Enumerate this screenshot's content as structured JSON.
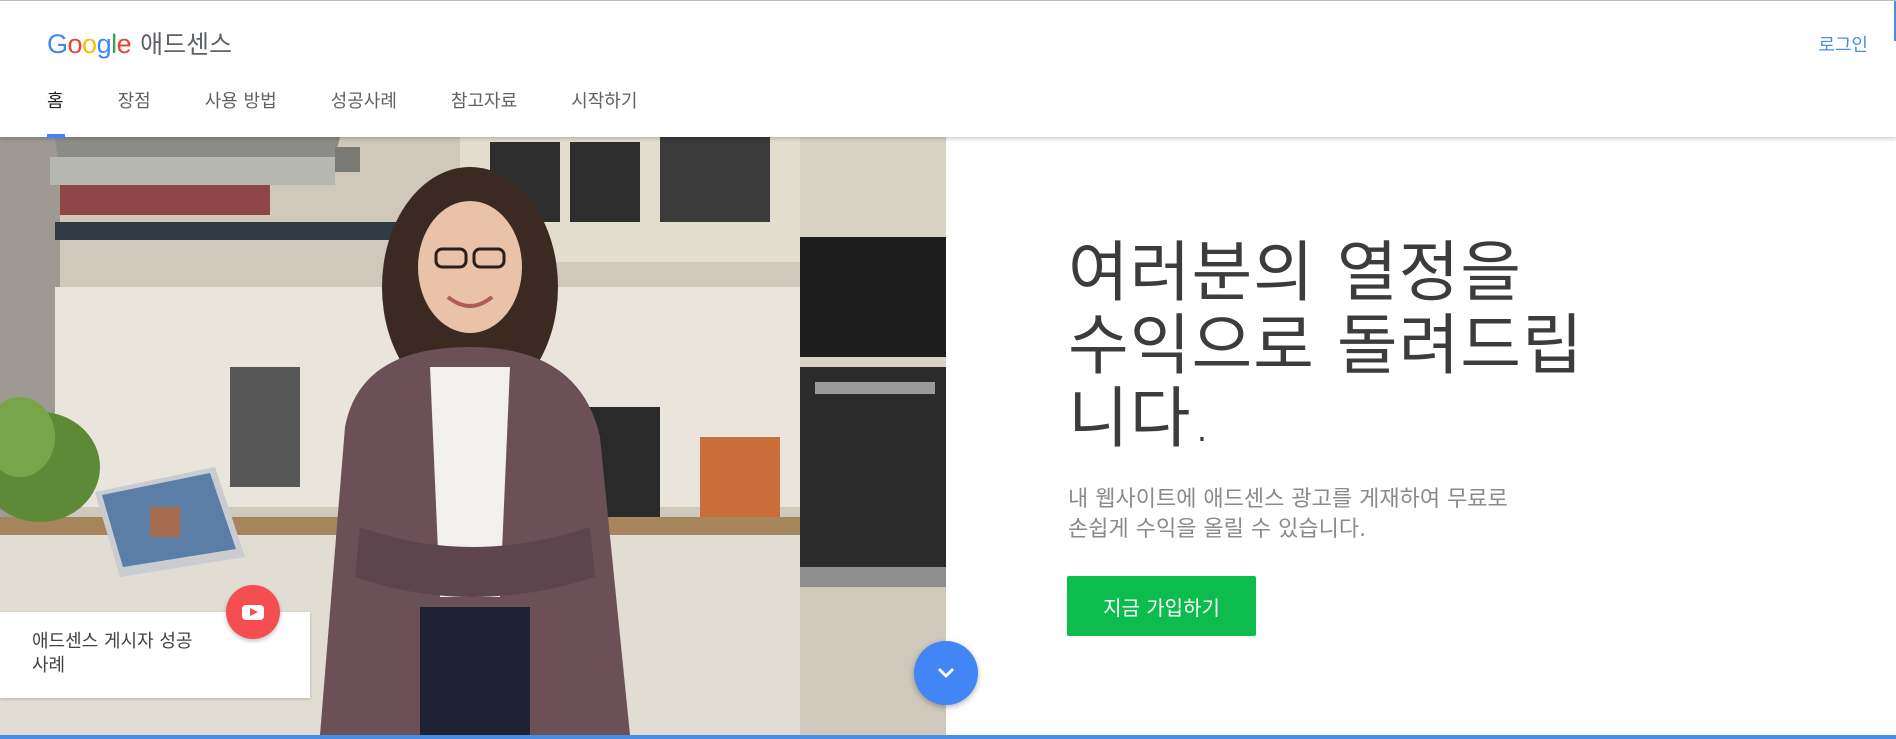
{
  "header": {
    "logo_letters": [
      {
        "ch": "G",
        "color": "#4285f4"
      },
      {
        "ch": "o",
        "color": "#ea4335"
      },
      {
        "ch": "o",
        "color": "#fbbc05"
      },
      {
        "ch": "g",
        "color": "#4285f4"
      },
      {
        "ch": "l",
        "color": "#34a853"
      },
      {
        "ch": "e",
        "color": "#ea4335"
      }
    ],
    "product_name": "애드센스",
    "login_label": "로그인"
  },
  "nav": {
    "items": [
      {
        "label": "홈",
        "active": true
      },
      {
        "label": "장점",
        "active": false
      },
      {
        "label": "사용 방법",
        "active": false
      },
      {
        "label": "성공사례",
        "active": false
      },
      {
        "label": "참고자료",
        "active": false
      },
      {
        "label": "시작하기",
        "active": false
      }
    ]
  },
  "hero": {
    "title_lines": [
      "여러분의 열정을",
      "수익으로 돌려드립",
      "니다."
    ],
    "subtitle_lines": [
      "내 웹사이트에 애드센스 광고를 게재하여 무료로",
      "손쉽게 수익을 올릴 수 있습니다."
    ],
    "cta_label": "지금 가입하기",
    "photo": "woman-in-kitchen-photo"
  },
  "case_card": {
    "label_lines": [
      "애드센스 게시자 성공",
      "사례"
    ],
    "play_icon": "youtube-play-icon"
  },
  "scroll_icon": "chevron-down-icon",
  "colors": {
    "accent": "#4285f4",
    "cta": "#0cbd4e",
    "play": "#f44d52",
    "link": "#4a8de6"
  }
}
